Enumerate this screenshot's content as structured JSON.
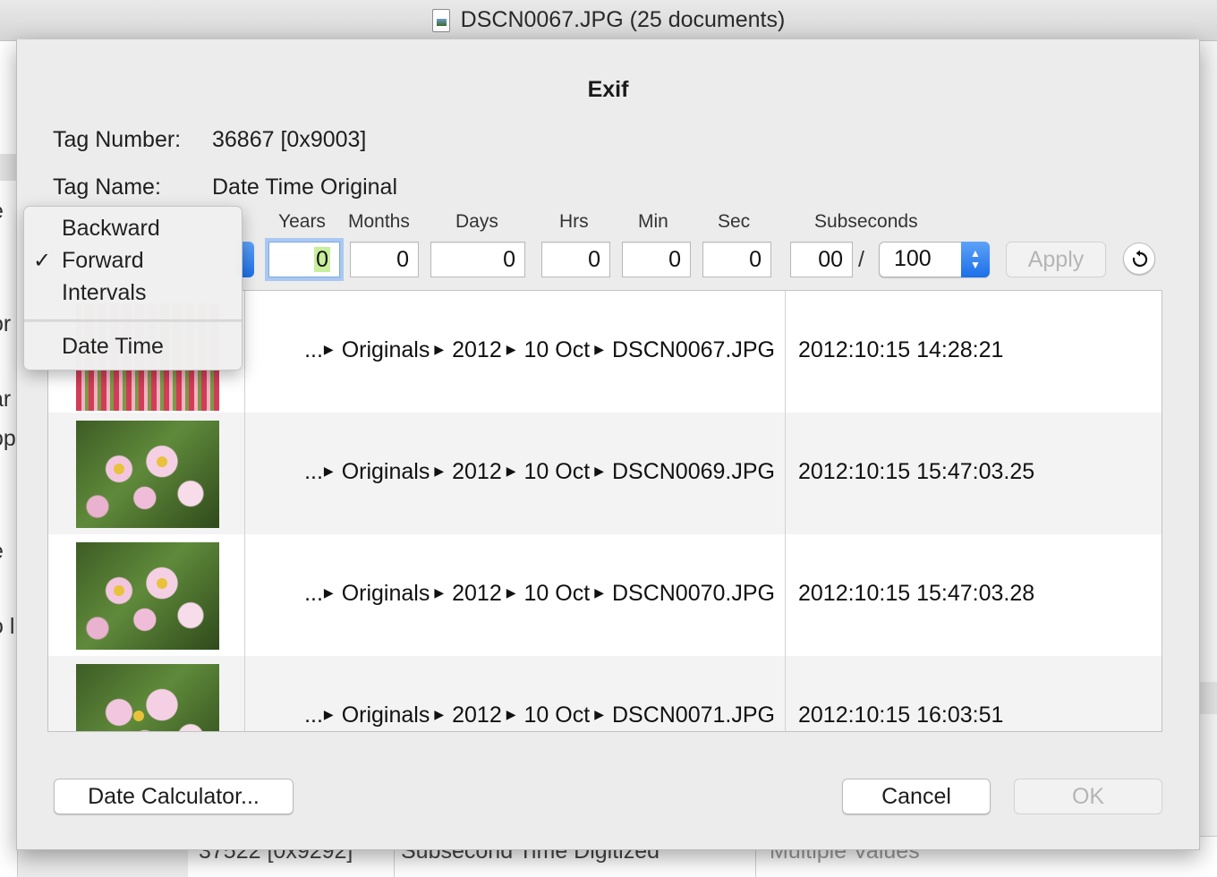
{
  "window": {
    "title": "DSCN0067.JPG (25 documents)"
  },
  "background": {
    "left_fragments": [
      "e",
      "or",
      "ar",
      "op",
      "e",
      "o l"
    ],
    "bottom_row": {
      "tag_number": "37522 [0x9292]",
      "tag_name": "Subsecond Time Digitized",
      "value": "Multiple Values"
    }
  },
  "dialog": {
    "title": "Exif",
    "tag_number_label": "Tag Number:",
    "tag_number_value": "36867 [0x9003]",
    "tag_name_label": "Tag Name:",
    "tag_name_value": "Date Time Original",
    "columns": {
      "years": "Years",
      "months": "Months",
      "days": "Days",
      "hrs": "Hrs",
      "min": "Min",
      "sec": "Sec",
      "subseconds": "Subseconds"
    },
    "values": {
      "years": "0",
      "months": "0",
      "days": "0",
      "hrs": "0",
      "min": "0",
      "sec": "0",
      "subseconds": "00",
      "subseconds_slash": "/",
      "subseconds_divisor": "100"
    },
    "apply_label": "Apply",
    "reset_icon": "reset-icon",
    "date_calculator_label": "Date Calculator...",
    "cancel_label": "Cancel",
    "ok_label": "OK"
  },
  "mode_menu": {
    "items": [
      {
        "label": "Backward",
        "checked": false
      },
      {
        "label": "Forward",
        "checked": true
      },
      {
        "label": "Intervals",
        "checked": false
      },
      {
        "label": "Date Time",
        "checked": false
      }
    ],
    "check_mark": "✓"
  },
  "files": [
    {
      "ellipsis": "...",
      "path": [
        "Originals",
        "2012",
        "10 Oct",
        "DSCN0067.JPG"
      ],
      "date": "2012:10:15 14:28:21"
    },
    {
      "ellipsis": "...",
      "path": [
        "Originals",
        "2012",
        "10 Oct",
        "DSCN0069.JPG"
      ],
      "date": "2012:10:15 15:47:03.25"
    },
    {
      "ellipsis": "...",
      "path": [
        "Originals",
        "2012",
        "10 Oct",
        "DSCN0070.JPG"
      ],
      "date": "2012:10:15 15:47:03.28"
    },
    {
      "ellipsis": "...",
      "path": [
        "Originals",
        "2012",
        "10 Oct",
        "DSCN0071.JPG"
      ],
      "date": "2012:10:15 16:03:51"
    }
  ],
  "colors": {
    "accent_blue": "#1b6fe8",
    "focus_ring": "#a9c8f2",
    "field_highlight": "#c8ef9c",
    "disabled_text": "#b5b5b5"
  }
}
